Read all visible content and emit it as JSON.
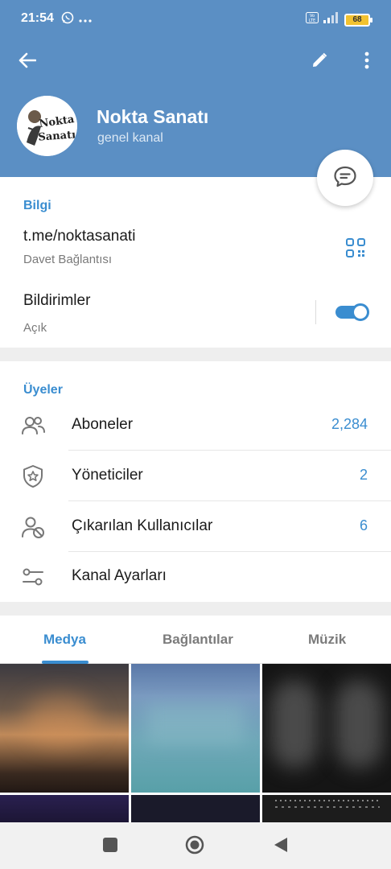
{
  "status_bar": {
    "time": "21:54",
    "left_icons": [
      "whatsapp-icon",
      "more-dots-icon"
    ],
    "right_icons": [
      "volte-icon",
      "signal-icon"
    ],
    "battery_level": "68"
  },
  "header": {
    "back_icon": "arrow-left-icon",
    "edit_icon": "pencil-icon",
    "menu_icon": "more-vertical-icon",
    "channel_name": "Nokta Sanatı",
    "channel_subtitle": "genel kanal",
    "avatar_logo_text": [
      "Nokta",
      "Sanatı"
    ],
    "color": "#5b8fc4"
  },
  "fab": {
    "icon": "chat-bubble-icon"
  },
  "info": {
    "title": "Bilgi",
    "link": "t.me/noktasanati",
    "link_caption": "Davet Bağlantısı",
    "qr_icon": "qr-code-icon",
    "notifications_label": "Bildirimler",
    "notifications_state": "Açık",
    "notifications_enabled": true
  },
  "members": {
    "title": "Üyeler",
    "rows": [
      {
        "label": "Aboneler",
        "count": "2,284",
        "icon": "people-icon"
      },
      {
        "label": "Yöneticiler",
        "count": "2",
        "icon": "shield-star-icon"
      },
      {
        "label": "Çıkarılan Kullanıcılar",
        "count": "6",
        "icon": "user-blocked-icon"
      },
      {
        "label": "Kanal Ayarları",
        "count": "",
        "icon": "sliders-icon"
      }
    ]
  },
  "tabs": {
    "items": [
      "Medya",
      "Bağlantılar",
      "Müzik"
    ],
    "active": "Medya"
  },
  "media": {
    "tile_count": 6
  },
  "nav_bar": {
    "icons": [
      "square-recents-icon",
      "circle-home-icon",
      "triangle-back-icon"
    ]
  },
  "colors": {
    "accent": "#3a8dd0",
    "header": "#5b8fc4",
    "divider_band": "#eeeeee"
  }
}
